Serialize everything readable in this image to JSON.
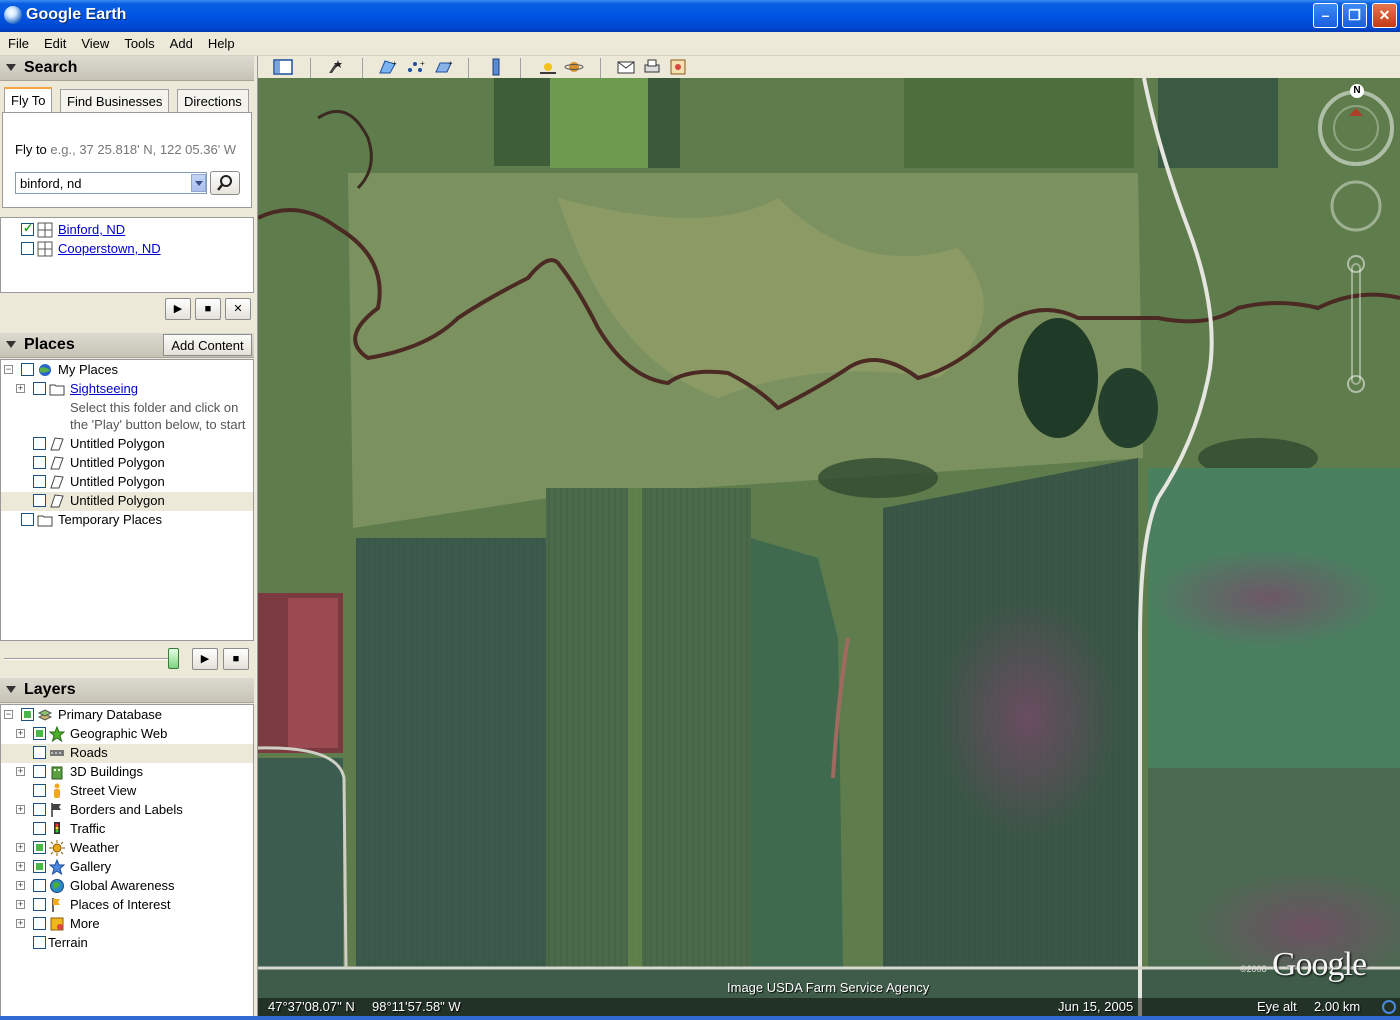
{
  "window": {
    "title": "Google Earth"
  },
  "menu": [
    "File",
    "Edit",
    "View",
    "Tools",
    "Add",
    "Help"
  ],
  "search": {
    "header": "Search",
    "tabs": [
      "Fly To",
      "Find Businesses",
      "Directions"
    ],
    "flyto_label": "Fly to",
    "flyto_hint": "e.g., 37 25.818' N, 122 05.36' W",
    "input_value": "binford, nd",
    "results": [
      {
        "label": "Binford, ND",
        "checked": true
      },
      {
        "label": "Cooperstown, ND",
        "checked": false
      }
    ]
  },
  "places": {
    "header": "Places",
    "add_content": "Add Content",
    "my_places": "My Places",
    "sightseeing": "Sightseeing",
    "sightseeing_desc_1": "Select this folder and click on",
    "sightseeing_desc_2": "the 'Play' button below, to start",
    "polygons": [
      "Untitled Polygon",
      "Untitled Polygon",
      "Untitled Polygon",
      "Untitled Polygon"
    ],
    "temporary": "Temporary Places"
  },
  "layers": {
    "header": "Layers",
    "primary": "Primary Database",
    "items": [
      {
        "label": "Geographic Web",
        "state": "partial",
        "expand": true
      },
      {
        "label": "Roads",
        "state": "off",
        "expand": false
      },
      {
        "label": "3D Buildings",
        "state": "off",
        "expand": true
      },
      {
        "label": "Street View",
        "state": "off",
        "expand": false
      },
      {
        "label": "Borders and Labels",
        "state": "off",
        "expand": true
      },
      {
        "label": "Traffic",
        "state": "off",
        "expand": false
      },
      {
        "label": "Weather",
        "state": "partial",
        "expand": true
      },
      {
        "label": "Gallery",
        "state": "partial",
        "expand": true
      },
      {
        "label": "Global Awareness",
        "state": "off",
        "expand": true
      },
      {
        "label": "Places of Interest",
        "state": "off",
        "expand": true
      },
      {
        "label": "More",
        "state": "off",
        "expand": true
      },
      {
        "label": "Terrain",
        "state": "off",
        "expand": false
      }
    ]
  },
  "map": {
    "imagery_credit": "Image USDA Farm Service Agency",
    "latitude": "47°37'08.07\" N",
    "longitude": "98°11'57.58\" W",
    "date": "Jun 15, 2005",
    "eye_alt_label": "Eye alt",
    "eye_alt_value": "2.00 km",
    "logo": "Google",
    "copyright": "©2008",
    "compass_n": "N"
  },
  "colors": {
    "titlebar": "#0054e3",
    "panel_bg": "#ece9d8",
    "link": "#0000cc",
    "field_dark": "#3c5a4a",
    "field_green": "#4a7a4c",
    "river": "#5a2c22"
  }
}
